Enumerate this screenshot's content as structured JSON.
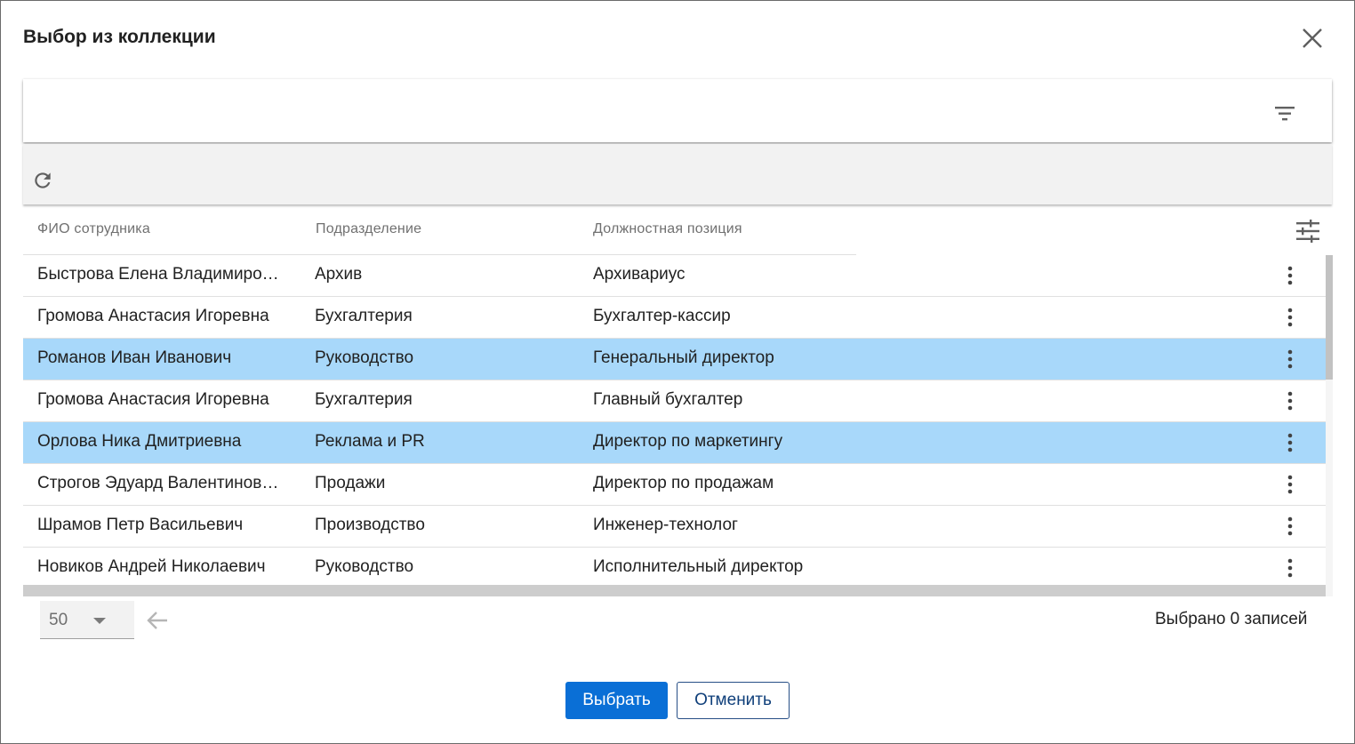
{
  "dialog": {
    "title": "Выбор из коллекции",
    "close_icon": "close-icon"
  },
  "filter": {
    "icon": "filter-icon"
  },
  "toolbar": {
    "refresh_icon": "refresh-icon"
  },
  "grid": {
    "columns": [
      {
        "label": "ФИО сотрудника"
      },
      {
        "label": "Подразделение"
      },
      {
        "label": "Должностная позиция"
      }
    ],
    "columns_settings_icon": "tune-icon",
    "row_menu_icon": "more-vert-icon",
    "selected_row_color": "#a8d8fa",
    "rows": [
      {
        "name": "Быстрова Елена Владимиро…",
        "department": "Архив",
        "position": "Архивариус",
        "selected": false
      },
      {
        "name": "Громова Анастасия Игоревна",
        "department": "Бухгалтерия",
        "position": "Бухгалтер-кассир",
        "selected": false
      },
      {
        "name": "Романов Иван Иванович",
        "department": "Руководство",
        "position": "Генеральный директор",
        "selected": true
      },
      {
        "name": "Громова Анастасия Игоревна",
        "department": "Бухгалтерия",
        "position": "Главный бухгалтер",
        "selected": false
      },
      {
        "name": "Орлова Ника Дмитриевна",
        "department": "Реклама и PR",
        "position": "Директор по маркетингу",
        "selected": true
      },
      {
        "name": "Строгов Эдуард Валентинов…",
        "department": "Продажи",
        "position": "Директор по продажам",
        "selected": false
      },
      {
        "name": "Шрамов Петр Васильевич",
        "department": "Производство",
        "position": "Инженер-технолог",
        "selected": false
      },
      {
        "name": "Новиков Андрей Николаевич",
        "department": "Руководство",
        "position": "Исполнительный директор",
        "selected": false
      }
    ]
  },
  "pagination": {
    "page_size": "50",
    "prev_icon": "arrow-left-icon",
    "selected_text": "Выбрано 0 записей"
  },
  "actions": {
    "select_label": "Выбрать",
    "cancel_label": "Отменить",
    "primary_color": "#0a6fd6"
  }
}
